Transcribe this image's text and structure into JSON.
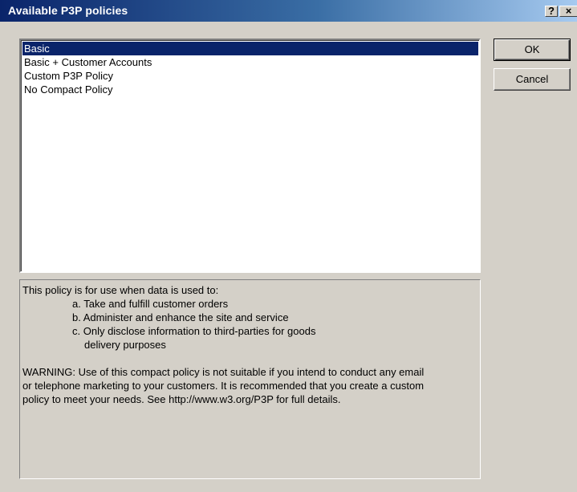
{
  "window": {
    "title": "Available P3P policies",
    "help_label": "?",
    "close_label": "×"
  },
  "policies": {
    "items": [
      {
        "label": "Basic",
        "selected": true
      },
      {
        "label": "Basic + Customer Accounts",
        "selected": false
      },
      {
        "label": "Custom P3P Policy",
        "selected": false
      },
      {
        "label": "No Compact Policy",
        "selected": false
      }
    ]
  },
  "buttons": {
    "ok": "OK",
    "cancel": "Cancel"
  },
  "description": {
    "intro": "This policy is for use when data is used to:",
    "point_a": "a. Take and fulfill customer orders",
    "point_b": "b. Administer and enhance the site and service",
    "point_c": "c. Only disclose information to third-parties for goods",
    "point_c_cont": "delivery purposes",
    "warning_1": "WARNING: Use of this compact policy is not suitable if you intend to conduct any email",
    "warning_2": "or telephone marketing to your customers. It is recommended that you create a custom",
    "warning_3": "policy to meet your needs. See http://www.w3.org/P3P for full details."
  },
  "colors": {
    "titlebar_start": "#0a246a",
    "titlebar_end": "#a6caf0",
    "selection": "#0a246a",
    "face": "#d4d0c8"
  }
}
